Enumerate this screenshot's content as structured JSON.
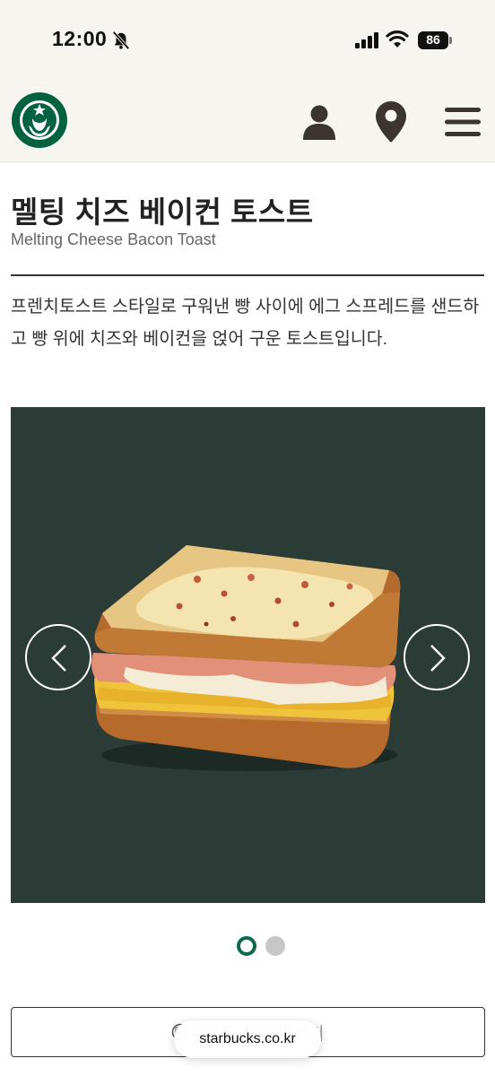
{
  "status_bar": {
    "time": "12:00",
    "battery": "86"
  },
  "header": {
    "logo_icon": "starbucks-siren-logo",
    "icons": [
      "user-icon",
      "map-pin-icon",
      "hamburger-menu-icon"
    ]
  },
  "product": {
    "name_ko": "멜팅 치즈 베이컨 토스트",
    "name_en": "Melting Cheese Bacon Toast",
    "description": "프렌치토스트 스타일로 구워낸 빵 사이에 에그 스프레드를 샌드하고 빵 위에 치즈와 베이컨을 얹어 구운 토스트입니다."
  },
  "carousel": {
    "background": "#2b3b36",
    "prev_icon": "chevron-left-icon",
    "next_icon": "chevron-right-icon",
    "slide_count": 2,
    "active_slide": 1
  },
  "nutrition_button": {
    "label": "다이어트 정보 더보기"
  },
  "browser": {
    "url": "starbucks.co.kr"
  },
  "colors": {
    "brand_green": "#006241",
    "header_bg": "#f6f5ef",
    "icon_brown": "#3b3431"
  }
}
